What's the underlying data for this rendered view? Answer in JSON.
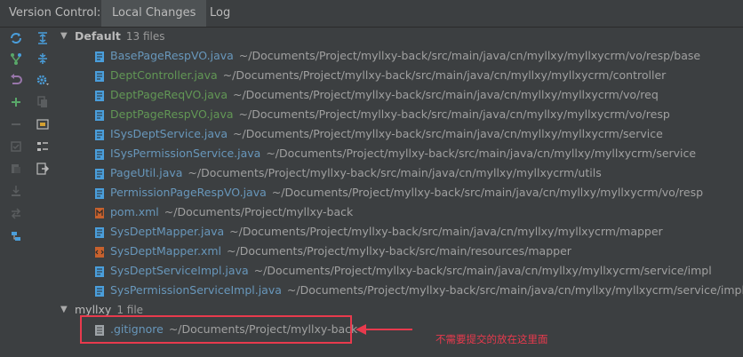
{
  "header": {
    "title": "Version Control:",
    "tabs": [
      {
        "label": "Local Changes",
        "active": true
      },
      {
        "label": "Log",
        "active": false
      }
    ]
  },
  "toolbar": {
    "icons": [
      "refresh-icon",
      "vcs-branch-icon",
      "rollback-icon",
      "add-icon",
      "remove-icon",
      "checkbox-icon",
      "shelve-icon",
      "unshelve-icon",
      "move-icon",
      "connect-icon",
      "expand-all-icon",
      "collapse-all-icon",
      "settings-icon",
      "copy-icon",
      "preview-icon",
      "group-by-icon",
      "export-icon"
    ]
  },
  "groups": [
    {
      "name": "Default",
      "count": "13 files",
      "files": [
        {
          "name": "BasePageRespVO.java",
          "path": "~/Documents/Project/myllxy-back/src/main/java/cn/myllxy/myllxycrm/vo/resp/base",
          "status": "modified"
        },
        {
          "name": "DeptController.java",
          "path": "~/Documents/Project/myllxy-back/src/main/java/cn/myllxy/myllxycrm/controller",
          "status": "added"
        },
        {
          "name": "DeptPageReqVO.java",
          "path": "~/Documents/Project/myllxy-back/src/main/java/cn/myllxy/myllxycrm/vo/req",
          "status": "added"
        },
        {
          "name": "DeptPageRespVO.java",
          "path": "~/Documents/Project/myllxy-back/src/main/java/cn/myllxy/myllxycrm/vo/resp",
          "status": "added"
        },
        {
          "name": "ISysDeptService.java",
          "path": "~/Documents/Project/myllxy-back/src/main/java/cn/myllxy/myllxycrm/service",
          "status": "modified"
        },
        {
          "name": "ISysPermissionService.java",
          "path": "~/Documents/Project/myllxy-back/src/main/java/cn/myllxy/myllxycrm/service",
          "status": "modified"
        },
        {
          "name": "PageUtil.java",
          "path": "~/Documents/Project/myllxy-back/src/main/java/cn/myllxy/myllxycrm/utils",
          "status": "modified"
        },
        {
          "name": "PermissionPageRespVO.java",
          "path": "~/Documents/Project/myllxy-back/src/main/java/cn/myllxy/myllxycrm/vo/resp",
          "status": "modified"
        },
        {
          "name": "pom.xml",
          "path": "~/Documents/Project/myllxy-back",
          "status": "modified"
        },
        {
          "name": "SysDeptMapper.java",
          "path": "~/Documents/Project/myllxy-back/src/main/java/cn/myllxy/myllxycrm/mapper",
          "status": "modified"
        },
        {
          "name": "SysDeptMapper.xml",
          "path": "~/Documents/Project/myllxy-back/src/main/resources/mapper",
          "status": "modified"
        },
        {
          "name": "SysDeptServiceImpl.java",
          "path": "~/Documents/Project/myllxy-back/src/main/java/cn/myllxy/myllxycrm/service/impl",
          "status": "modified"
        },
        {
          "name": "SysPermissionServiceImpl.java",
          "path": "~/Documents/Project/myllxy-back/src/main/java/cn/myllxy/myllxycrm/service/impl",
          "status": "modified"
        }
      ]
    },
    {
      "name": "myllxy",
      "count": "1 file",
      "files": [
        {
          "name": ".gitignore",
          "path": "~/Documents/Project/myllxy-back",
          "status": "modified"
        }
      ]
    }
  ],
  "annotation": {
    "text": "不需要提交的放在这里面",
    "color": "#e83a4d"
  },
  "colors": {
    "modified": "#6897bb",
    "added": "#629755",
    "accent": "#e83a4d"
  }
}
